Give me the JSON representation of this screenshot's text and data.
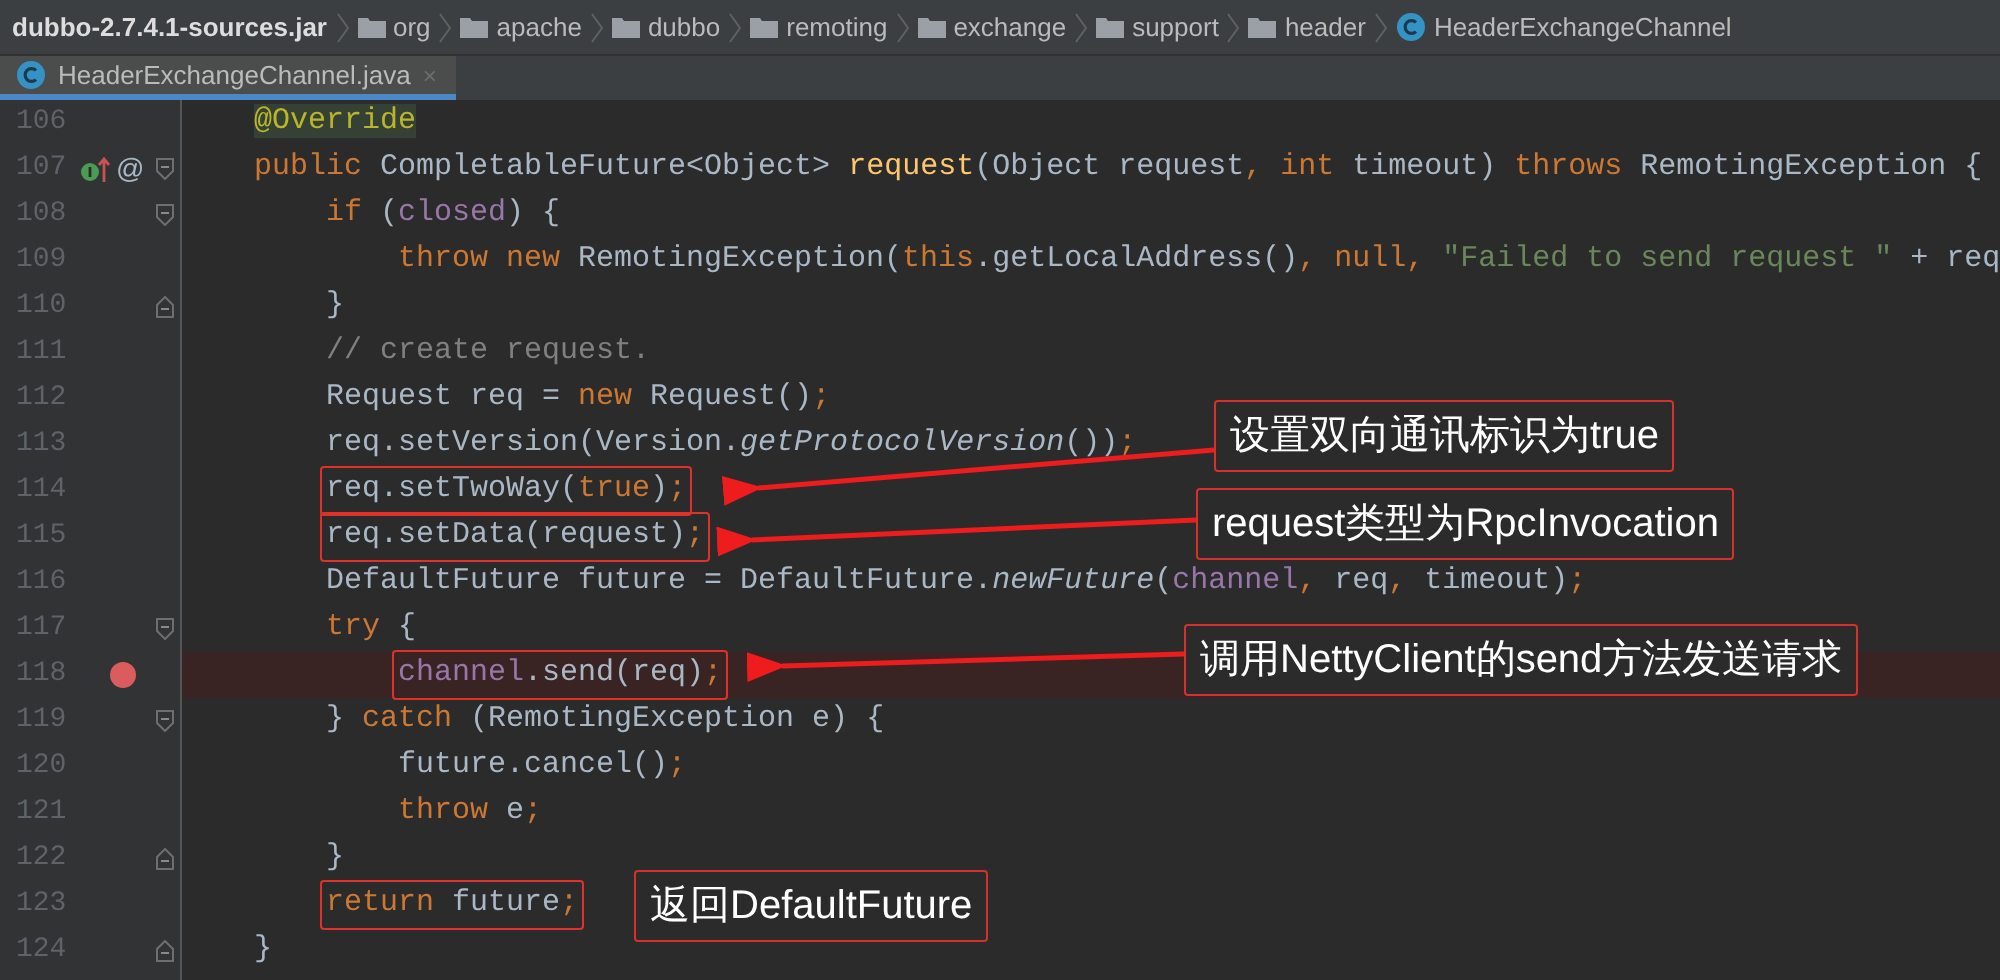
{
  "breadcrumbs": [
    {
      "kind": "jar",
      "label": "dubbo-2.7.4.1-sources.jar"
    },
    {
      "kind": "folder",
      "label": "org"
    },
    {
      "kind": "folder",
      "label": "apache"
    },
    {
      "kind": "folder",
      "label": "dubbo"
    },
    {
      "kind": "folder",
      "label": "remoting"
    },
    {
      "kind": "folder",
      "label": "exchange"
    },
    {
      "kind": "folder",
      "label": "support"
    },
    {
      "kind": "folder",
      "label": "header"
    },
    {
      "kind": "class",
      "label": "HeaderExchangeChannel"
    }
  ],
  "tabs": [
    {
      "label": "HeaderExchangeChannel.java",
      "close": "×",
      "selected": true
    }
  ],
  "lines": [
    {
      "number": "106",
      "tokens": [
        {
          "kind": "ann",
          "text": "@Override"
        }
      ]
    },
    {
      "number": "107",
      "implements": true,
      "override_mark": "@",
      "fold_start": true,
      "tokens": [
        {
          "kind": "kw",
          "text": "public "
        },
        {
          "kind": "plain",
          "text": "CompletableFuture<Object> "
        },
        {
          "kind": "fn",
          "text": "request"
        },
        {
          "kind": "plain",
          "text": "(Object request"
        },
        {
          "kind": "kw",
          "text": ", int "
        },
        {
          "kind": "plain",
          "text": "timeout) "
        },
        {
          "kind": "kw",
          "text": "throws "
        },
        {
          "kind": "plain",
          "text": "RemotingException {"
        }
      ],
      "children": [
        {
          "number": "108",
          "fold_start": true,
          "tokens": [
            {
              "kind": "kw",
              "text": "if "
            },
            {
              "kind": "plain",
              "text": "("
            },
            {
              "kind": "field",
              "text": "closed"
            },
            {
              "kind": "plain",
              "text": ") {"
            }
          ],
          "children": [
            {
              "number": "109",
              "tokens": [
                {
                  "kind": "kw",
                  "text": "throw new "
                },
                {
                  "kind": "plain",
                  "text": "RemotingException("
                },
                {
                  "kind": "kw",
                  "text": "this"
                },
                {
                  "kind": "plain",
                  "text": ".getLocalAddress()"
                },
                {
                  "kind": "kw",
                  "text": ", null, "
                },
                {
                  "kind": "string",
                  "text": "\"Failed to send request \""
                },
                {
                  "kind": "plain",
                  "text": " + req"
                }
              ]
            }
          ]
        },
        {
          "number": "110",
          "fold_end": true,
          "tokens": [
            {
              "kind": "plain",
              "text": "}"
            }
          ]
        },
        {
          "number": "111",
          "tokens": [
            {
              "kind": "comment",
              "text": "// create request."
            }
          ]
        },
        {
          "number": "112",
          "tokens": [
            {
              "kind": "plain",
              "text": "Request req = "
            },
            {
              "kind": "kw",
              "text": "new "
            },
            {
              "kind": "plain",
              "text": "Request()"
            },
            {
              "kind": "kw",
              "text": ";"
            }
          ]
        },
        {
          "number": "113",
          "tokens": [
            {
              "kind": "plain",
              "text": "req.setVersion(Version."
            },
            {
              "kind": "static",
              "text": "getProtocolVersion"
            },
            {
              "kind": "plain",
              "text": "())"
            },
            {
              "kind": "kw",
              "text": ";"
            }
          ]
        },
        {
          "number": "114",
          "boxed": true,
          "tokens": [
            {
              "kind": "plain",
              "text": "req.setTwoWay("
            },
            {
              "kind": "kw",
              "text": "true"
            },
            {
              "kind": "plain",
              "text": ")"
            },
            {
              "kind": "kw",
              "text": ";"
            }
          ]
        },
        {
          "number": "115",
          "boxed": true,
          "tokens": [
            {
              "kind": "plain",
              "text": "req.setData(request)"
            },
            {
              "kind": "kw",
              "text": ";"
            }
          ]
        },
        {
          "number": "116",
          "tokens": [
            {
              "kind": "plain",
              "text": "DefaultFuture future = DefaultFuture."
            },
            {
              "kind": "static",
              "text": "newFuture"
            },
            {
              "kind": "plain",
              "text": "("
            },
            {
              "kind": "field",
              "text": "channel"
            },
            {
              "kind": "kw",
              "text": ", "
            },
            {
              "kind": "plain",
              "text": "req"
            },
            {
              "kind": "kw",
              "text": ", "
            },
            {
              "kind": "plain",
              "text": "timeout)"
            },
            {
              "kind": "kw",
              "text": ";"
            }
          ]
        },
        {
          "number": "117",
          "fold_start": true,
          "tokens": [
            {
              "kind": "kw",
              "text": "try "
            },
            {
              "kind": "plain",
              "text": "{"
            }
          ],
          "children": [
            {
              "number": "118",
              "boxed": true,
              "breakpoint": true,
              "tokens": [
                {
                  "kind": "field",
                  "text": "channel"
                },
                {
                  "kind": "plain",
                  "text": ".send(req)"
                },
                {
                  "kind": "kw",
                  "text": ";"
                }
              ]
            }
          ]
        },
        {
          "number": "119",
          "fold_start": true,
          "tokens": [
            {
              "kind": "plain",
              "text": "} "
            },
            {
              "kind": "kw",
              "text": "catch "
            },
            {
              "kind": "plain",
              "text": "(RemotingException e) {"
            }
          ],
          "children": [
            {
              "number": "120",
              "tokens": [
                {
                  "kind": "plain",
                  "text": "future.cancel()"
                },
                {
                  "kind": "kw",
                  "text": ";"
                }
              ]
            },
            {
              "number": "121",
              "tokens": [
                {
                  "kind": "kw",
                  "text": "throw "
                },
                {
                  "kind": "plain",
                  "text": "e"
                },
                {
                  "kind": "kw",
                  "text": ";"
                }
              ]
            }
          ]
        },
        {
          "number": "122",
          "fold_end": true,
          "tokens": [
            {
              "kind": "plain",
              "text": "}"
            }
          ]
        },
        {
          "number": "123",
          "boxed": true,
          "tokens": [
            {
              "kind": "kw",
              "text": "return "
            },
            {
              "kind": "plain",
              "text": "future"
            },
            {
              "kind": "kw",
              "text": ";"
            }
          ]
        }
      ]
    },
    {
      "number": "124",
      "fold_end": true,
      "tokens": [
        {
          "kind": "plain",
          "text": "}"
        }
      ]
    }
  ],
  "callouts": [
    {
      "text": "设置双向通讯标识为true",
      "arrow": true
    },
    {
      "text": "request类型为RpcInvocation",
      "arrow": true
    },
    {
      "text": "调用NettyClient的send方法发送请求",
      "arrow": true
    },
    {
      "text": "返回DefaultFuture",
      "arrow": false
    }
  ]
}
